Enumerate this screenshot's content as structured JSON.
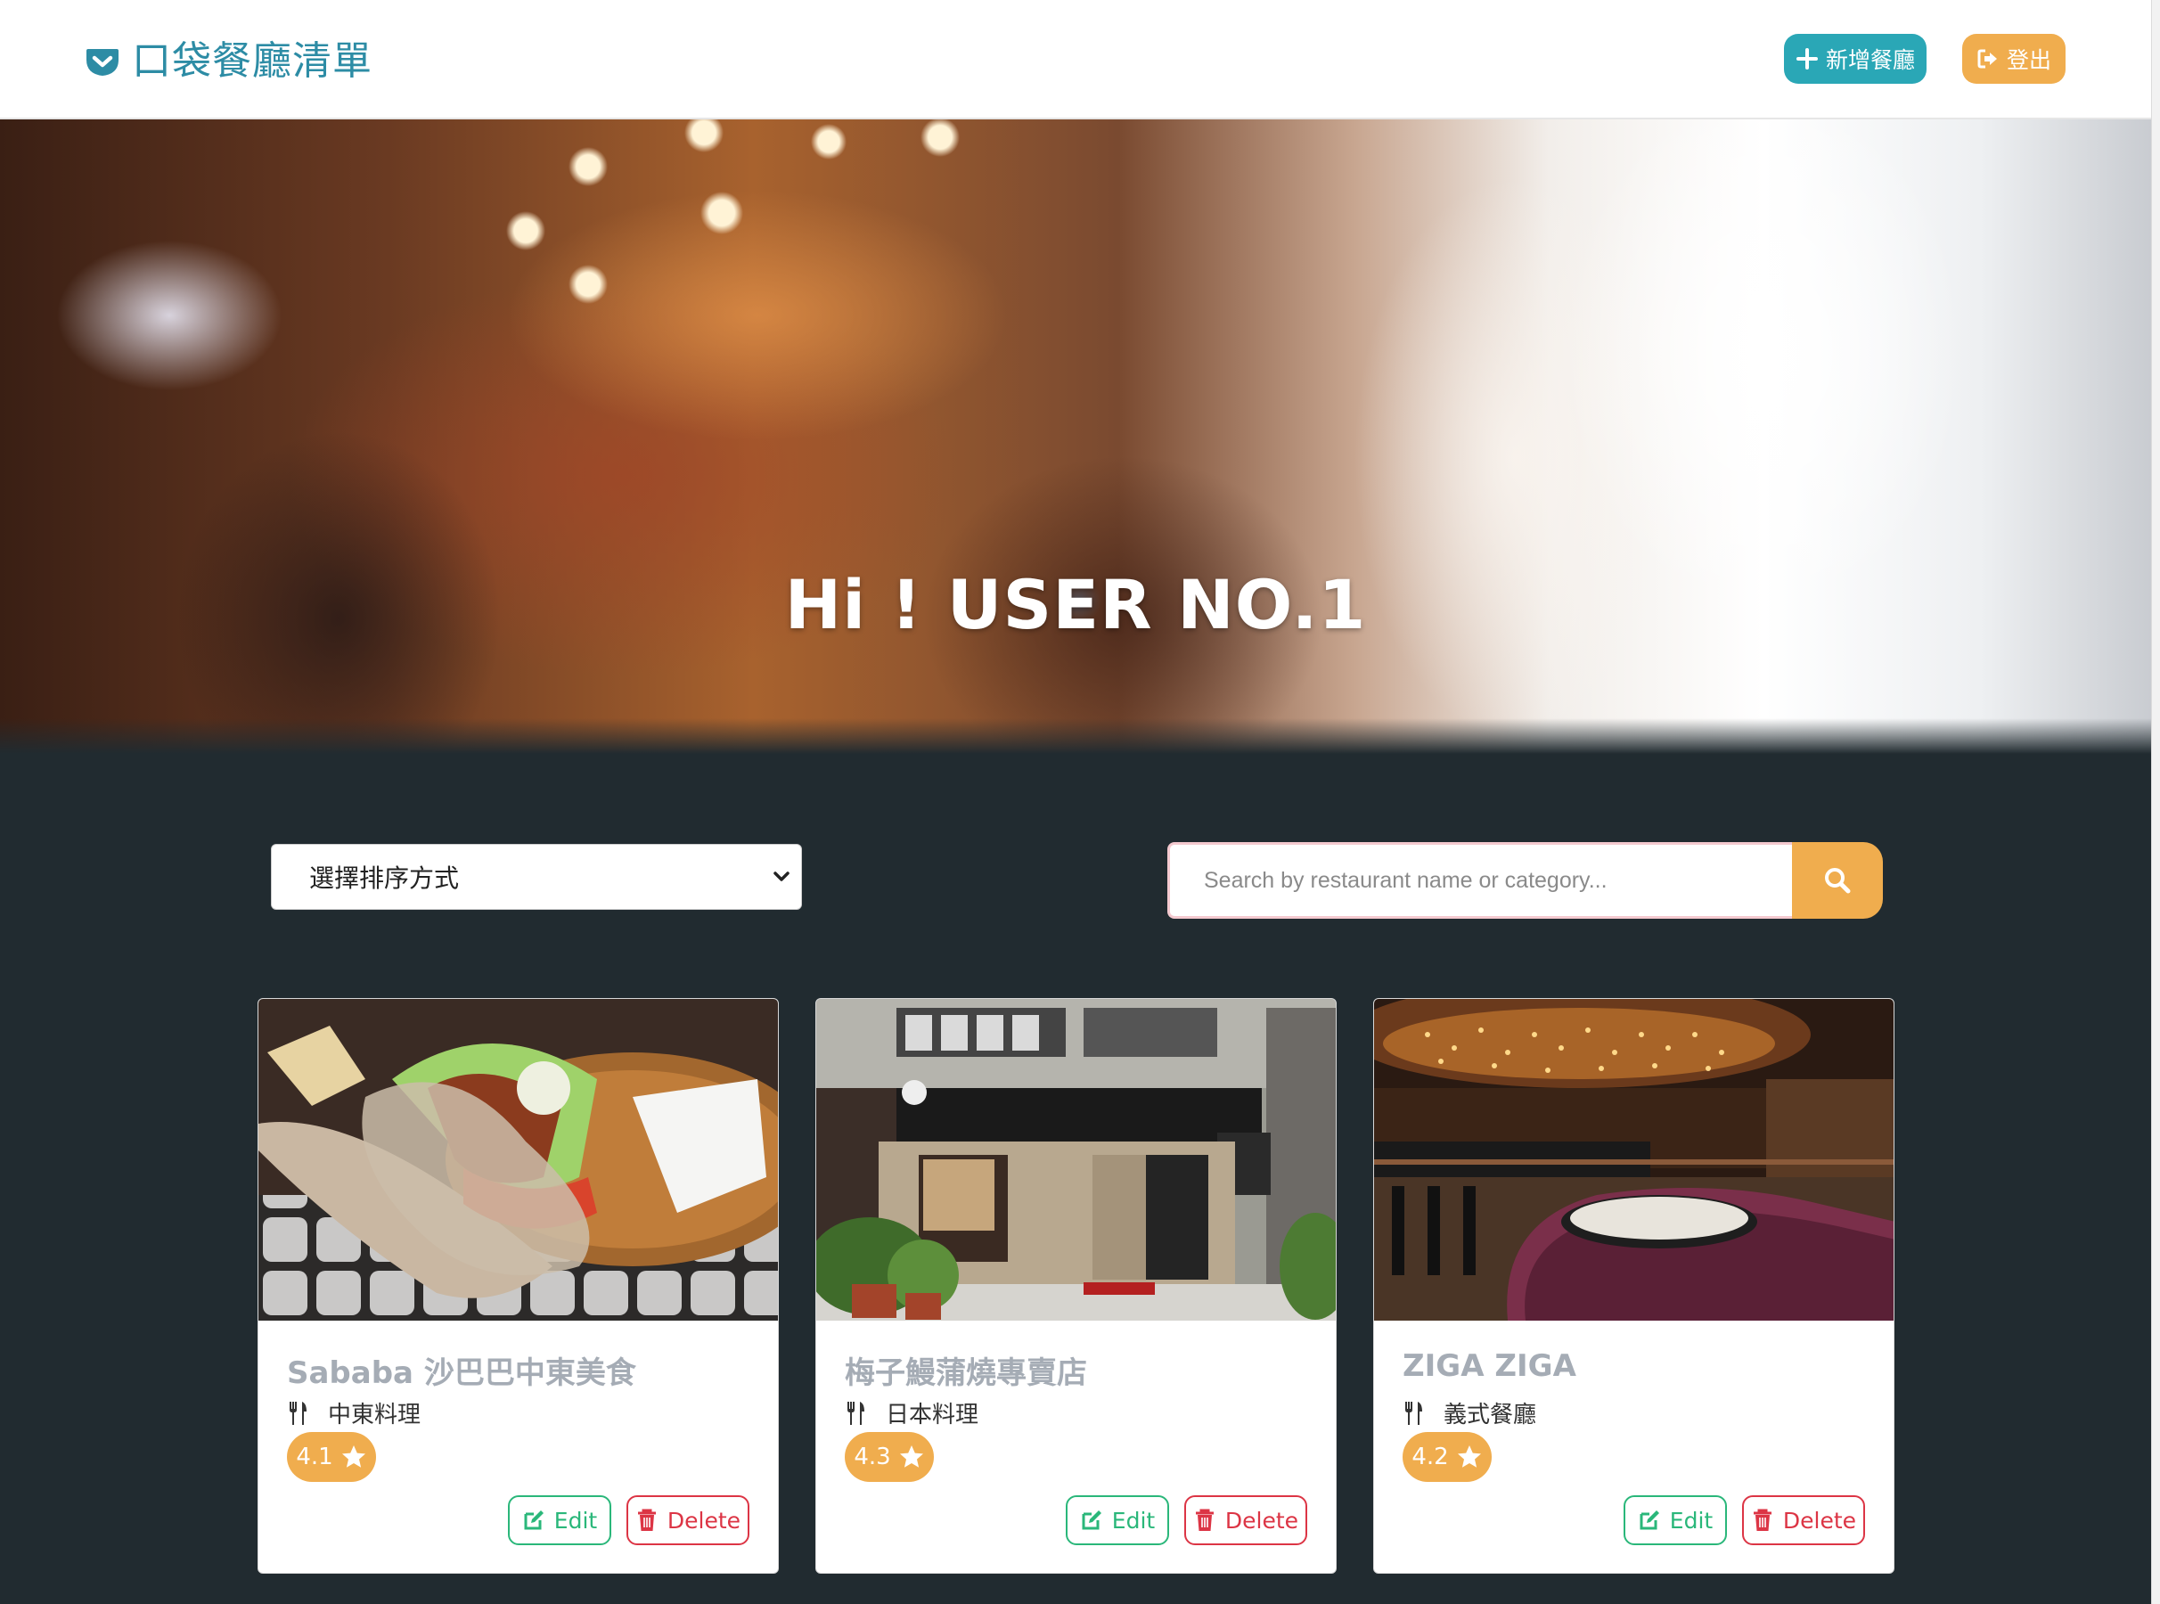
{
  "navbar": {
    "brand": "口袋餐廳清單",
    "brand_icon": "pocket-icon",
    "add_label": "新增餐廳",
    "add_icon": "plus-icon",
    "logout_label": "登出",
    "logout_icon": "sign-out-icon"
  },
  "hero": {
    "title": "Hi ! USER NO.1"
  },
  "controls": {
    "sort_selected": "選擇排序方式",
    "search_placeholder": "Search by restaurant name or category...",
    "search_icon": "search-icon"
  },
  "restaurants": [
    {
      "name": "Sababa 沙巴巴中東美食",
      "category": "中東料理",
      "rating": "4.1",
      "edit_label": "Edit",
      "delete_label": "Delete"
    },
    {
      "name": "梅子鰻蒲燒專賣店",
      "category": "日本料理",
      "rating": "4.3",
      "edit_label": "Edit",
      "delete_label": "Delete"
    },
    {
      "name": "ZIGA ZIGA",
      "category": "義式餐廳",
      "rating": "4.2",
      "edit_label": "Edit",
      "delete_label": "Delete"
    }
  ],
  "colors": {
    "brand": "#2d8ca5",
    "info": "#2aa7b6",
    "warning": "#f0ad4e",
    "success": "#2ab77a",
    "danger": "#dc3545",
    "page_bg": "#212b30"
  }
}
